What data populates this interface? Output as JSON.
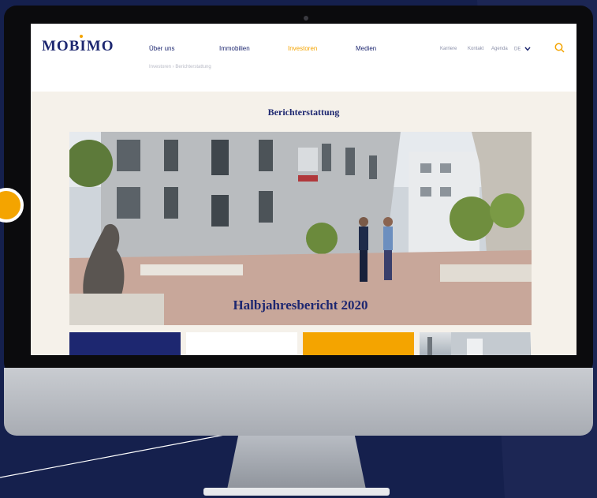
{
  "site": {
    "logo": "MOBIMO",
    "nav": [
      "Über uns",
      "Immobilien",
      "Investoren",
      "Medien"
    ],
    "active_nav": "Investoren",
    "utility": [
      "Karriere",
      "Kontakt",
      "Agenda"
    ],
    "language": "DE"
  },
  "breadcrumb": "Investoren  ›  Berichterstattung",
  "page_title": "Berichterstattung",
  "hero": {
    "caption": "Halbjahresbericht 2020"
  },
  "tiles": [
    {
      "name": "tile-navy",
      "color": "#1d2770"
    },
    {
      "name": "tile-white",
      "color": "#ffffff"
    },
    {
      "name": "tile-orange",
      "color": "#f4a400"
    },
    {
      "name": "tile-photo",
      "color": "#a9b2bb"
    }
  ],
  "colors": {
    "brand_navy": "#1d2770",
    "accent_orange": "#f4a400",
    "background": "#15204d"
  }
}
